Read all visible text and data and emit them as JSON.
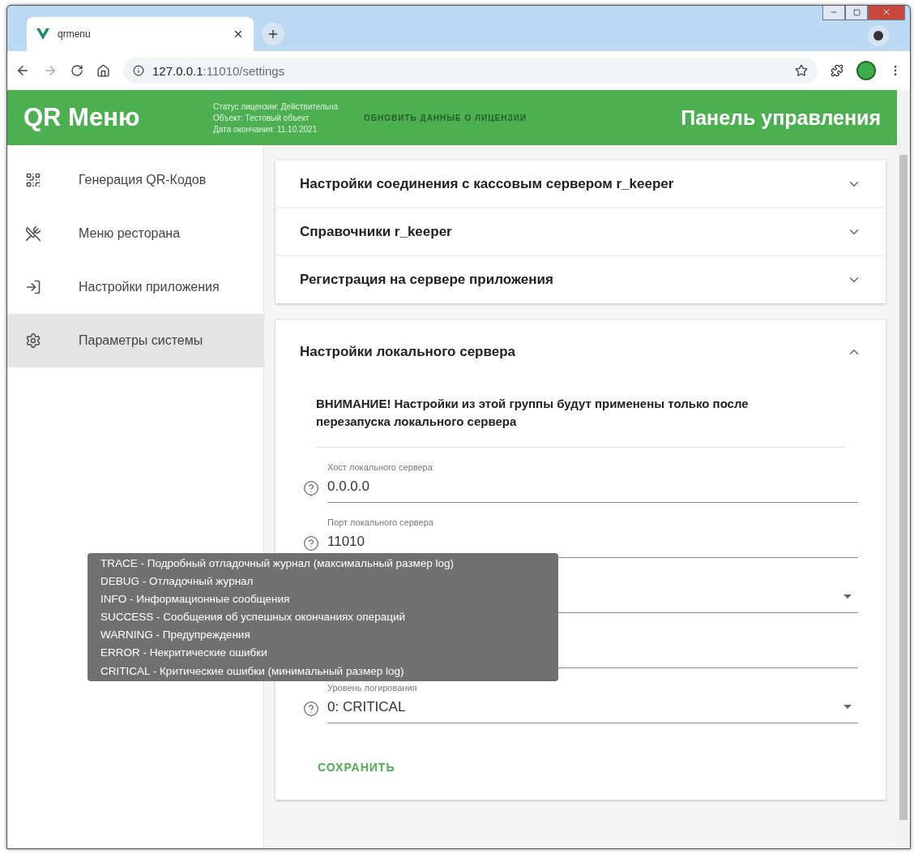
{
  "browser": {
    "tab_title": "qrmenu",
    "url_host": "127.0.0.1",
    "url_rest": ":11010/settings"
  },
  "header": {
    "title": "QR Меню",
    "license_lines": [
      "Статус лицензии: Действительна",
      "Объект: Тестовый объект",
      "Дата окончания: 11.10.2021"
    ],
    "refresh_button": {
      "label": "ОБНОВИТЬ ДАННЫЕ О ЛИЦЕНЗИИ",
      "disabled": true
    },
    "panel_title": "Панель управления"
  },
  "sidebar": {
    "items": [
      {
        "kind": "qr",
        "label": "Генерация QR-Кодов",
        "selected": false
      },
      {
        "kind": "menu",
        "label": "Меню ресторана",
        "selected": false
      },
      {
        "kind": "app",
        "label": "Настройки приложения",
        "selected": false
      },
      {
        "kind": "system",
        "label": "Параметры системы",
        "selected": true
      }
    ]
  },
  "sections": [
    {
      "title": "Настройки соединения с кассовым сервером r_keeper",
      "expanded": false
    },
    {
      "title": "Справочники r_keeper",
      "expanded": false
    },
    {
      "title": "Регистрация на сервере приложения",
      "expanded": false
    },
    {
      "title": "Настройки локального сервера",
      "expanded": true,
      "warning": "ВНИМАНИЕ! Настройки из этой группы будут применены только после перезапуска локального сервера",
      "fields": [
        {
          "kind": "text",
          "label": "Хост локального сервера",
          "value": "0.0.0.0"
        },
        {
          "kind": "text",
          "label": "Порт локального сервера",
          "value": "11010"
        },
        {
          "kind": "select"
        },
        {
          "kind": "text"
        },
        {
          "kind": "select",
          "label": "Уровень логирования",
          "value": "0: CRITICAL"
        }
      ],
      "save_label": "СОХРАНИТЬ"
    }
  ],
  "tooltip": [
    "TRACE - Подробный отладочный журнал (максимальный размер log)",
    "DEBUG - Отладочный журнал",
    "INFO - Информационные сообщения",
    "SUCCESS - Сообщения об успешных окончаниях операций",
    "WARNING - Предупреждения",
    "ERROR - Некритические ошибки",
    "CRITICAL - Критические ошибки (минимальный размер log)"
  ]
}
